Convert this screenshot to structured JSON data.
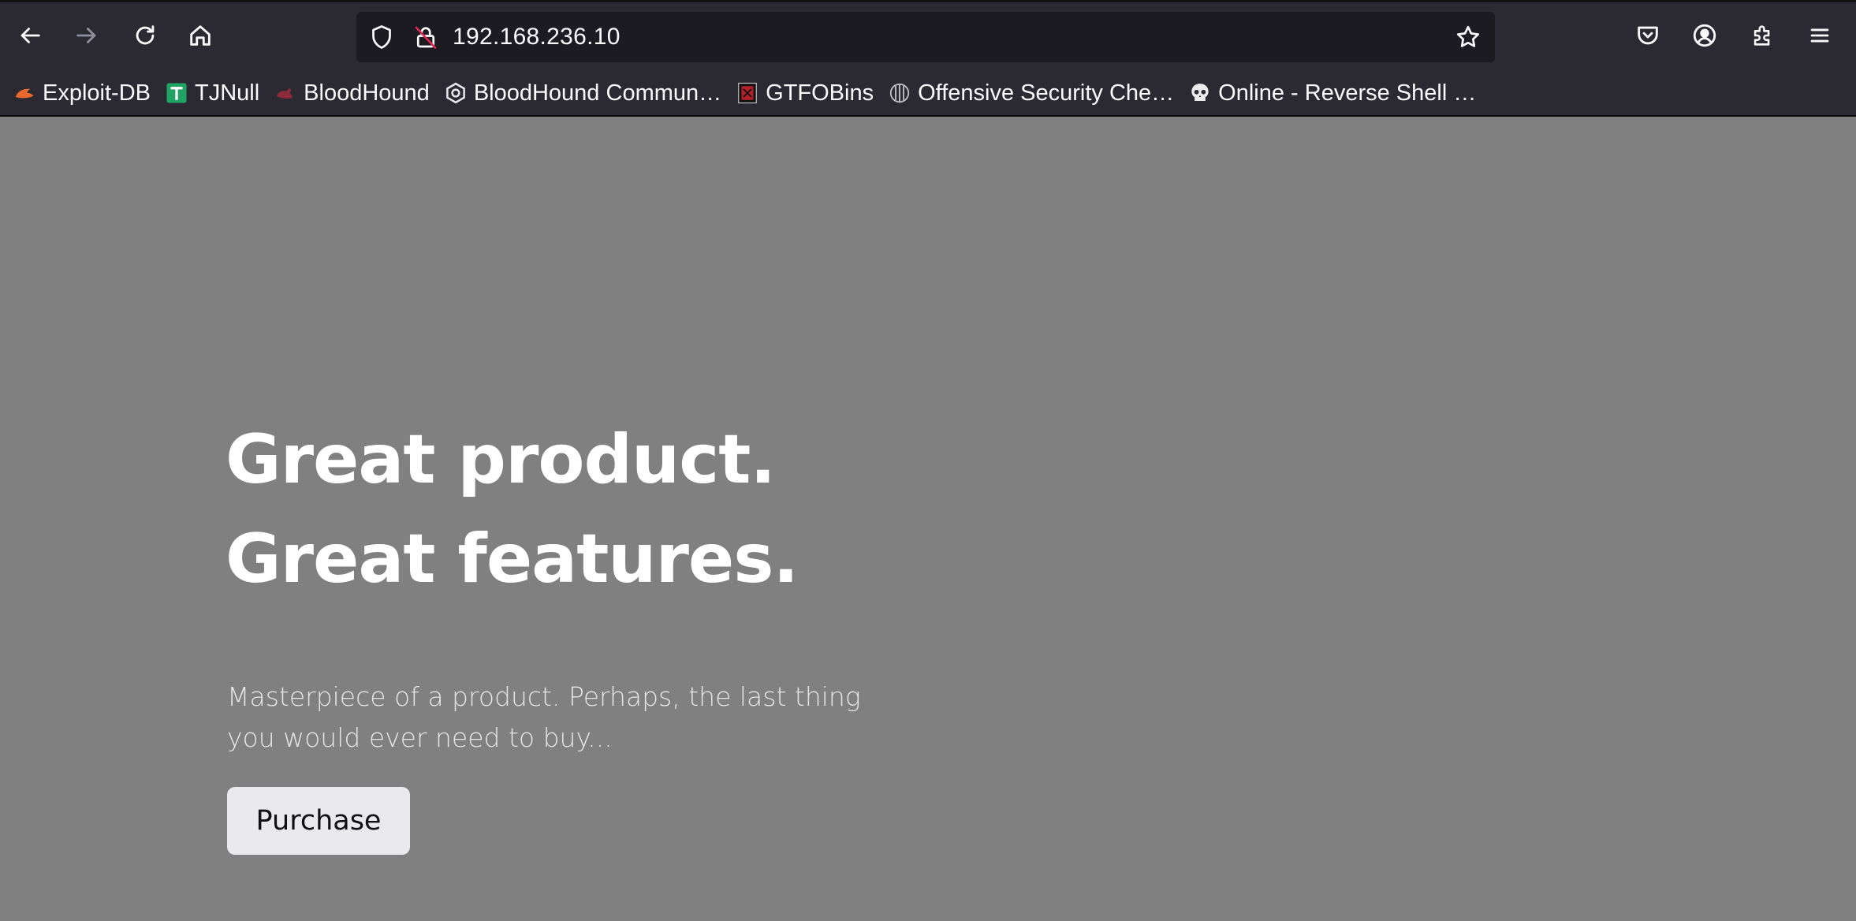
{
  "browser": {
    "url": "192.168.236.10",
    "toolbar_icons": {
      "back": "arrow-left-icon",
      "forward": "arrow-right-icon",
      "reload": "reload-icon",
      "home": "home-icon",
      "tracking_protection": "shield-icon",
      "connection": "insecure-lock-icon",
      "bookmark_star": "star-icon",
      "pocket": "pocket-icon",
      "account": "account-icon",
      "extensions": "puzzle-icon",
      "menu": "hamburger-menu-icon"
    },
    "bookmarks": [
      {
        "label": "Exploit-DB",
        "icon": "exploit-db-icon"
      },
      {
        "label": "TJNull",
        "icon": "tjnull-icon"
      },
      {
        "label": "BloodHound",
        "icon": "bloodhound-icon"
      },
      {
        "label": "BloodHound Commun…",
        "icon": "bloodhound-community-icon"
      },
      {
        "label": "GTFOBins",
        "icon": "gtfobins-icon"
      },
      {
        "label": "Offensive Security Che…",
        "icon": "offsec-cheatsheet-icon"
      },
      {
        "label": "Online - Reverse Shell …",
        "icon": "skull-icon"
      }
    ]
  },
  "page": {
    "hero": {
      "title_line1": "Great product.",
      "title_line2": "Great features.",
      "description": "Masterpiece of a product. Perhaps, the last thing you would ever need to buy...",
      "button_label": "Purchase"
    }
  },
  "colors": {
    "chrome_bg": "#2b2a33",
    "url_field_bg": "#1c1b22",
    "page_bg": "#808080",
    "button_bg": "#e9e9ee"
  }
}
